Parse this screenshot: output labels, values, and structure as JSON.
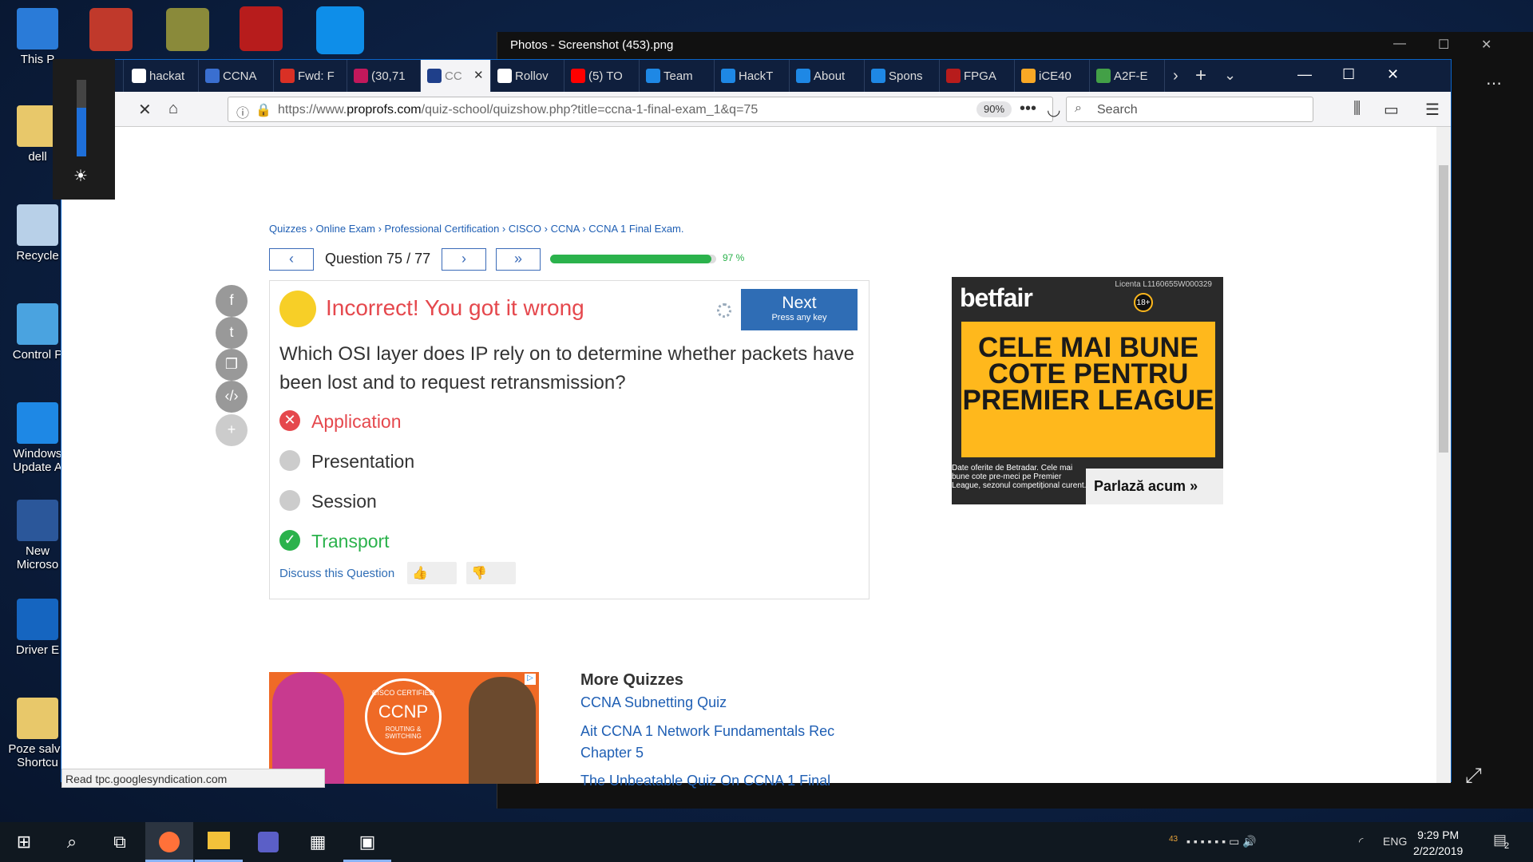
{
  "desktop": {
    "icons": [
      "This P",
      "dell",
      "Recycle",
      "Control P",
      "Windows Update A",
      "New Microso",
      "Driver E",
      "Poze salva Shortcu"
    ]
  },
  "photos": {
    "title": "Photos - Screenshot (453).png"
  },
  "browser": {
    "tabs": [
      "hackat",
      "CCNA",
      "Fwd: F",
      "(30,71",
      "CC",
      "Rollov",
      "(5) TO",
      "Team",
      "HackT",
      "About",
      "Spons",
      "FPGA",
      "iCE40",
      "A2F-E"
    ],
    "url_prefix": "https://www.",
    "url_domain": "proprofs.com",
    "url_rest": "/quiz-school/quizshow.php?title=ccna-1-final-exam_1&q=75",
    "zoom": "90%",
    "search_placeholder": "Search",
    "status": "Read tpc.googlesyndication.com"
  },
  "quiz": {
    "breadcrumbs": [
      "Quizzes",
      "Online Exam",
      "Professional Certification",
      "CISCO",
      "CCNA",
      "CCNA 1 Final Exam."
    ],
    "question_count": "Question 75 / 77",
    "progress": 0.97,
    "progress_label": "97 %",
    "result": "Incorrect! You got it wrong",
    "next_label": "Next",
    "next_sub": "Press any key",
    "question": "Which OSI layer does IP rely on to determine whether packets have been lost and to request retransmission?",
    "options": [
      {
        "label": "Application",
        "state": "wrong"
      },
      {
        "label": "Presentation",
        "state": "none"
      },
      {
        "label": "Session",
        "state": "none"
      },
      {
        "label": "Transport",
        "state": "correct"
      }
    ],
    "discuss": "Discuss this Question"
  },
  "ad": {
    "brand": "betfair",
    "license": "Licenta L1160655W000329",
    "headline": "CELE MAI BUNE COTE PENTRU PREMIER LEAGUE",
    "small": "Date oferite de Betradar. Cele mai bune cote pre-meci pe Premier League, sezonul competițional curent.",
    "cta": "Parlază acum",
    "age": "18+"
  },
  "ad2": {
    "badge_top": "CISCO CERTIFIED",
    "badge": "CCNP",
    "badge_sub": "ROUTING & SWITCHING"
  },
  "more": {
    "title": "More Quizzes",
    "links": [
      "CCNA Subnetting Quiz",
      "Ait CCNA 1 Network Fundamentals Rec Chapter 5",
      "The Unbeatable Quiz On CCNA 1 Final"
    ]
  },
  "taskbar": {
    "lang": "ENG",
    "time": "9:29 PM",
    "date": "2/22/2019",
    "notif": "2",
    "temp": "43"
  },
  "colors": {
    "accent": "#2f6db5",
    "wrong": "#e5484d",
    "correct": "#2bb24c"
  }
}
